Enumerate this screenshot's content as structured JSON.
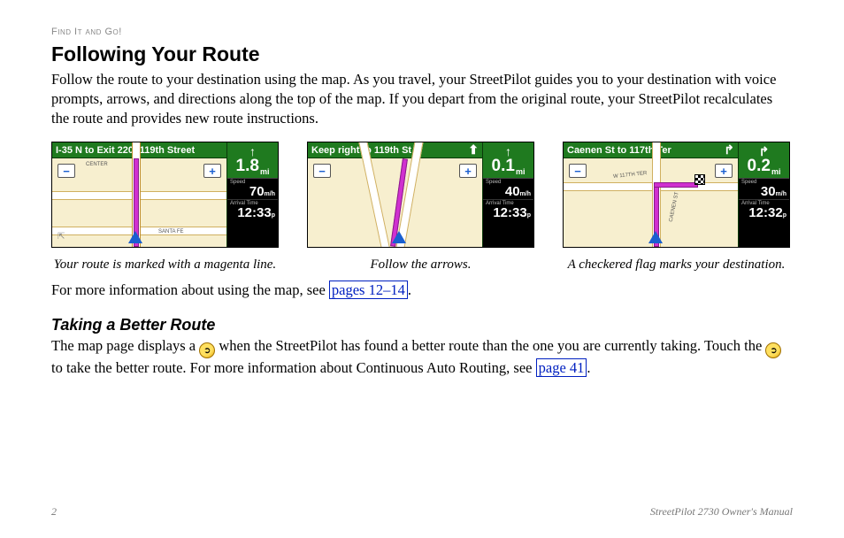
{
  "breadcrumb": "Find It and Go!",
  "heading": "Following Your Route",
  "intro": "Follow the route to your destination using the map. As you travel, your StreetPilot guides you to your destination with voice prompts, arrows, and directions along the top of the map. If you depart from the original route, your StreetPilot recalculates the route and provides new route instructions.",
  "figures": [
    {
      "topbar": "I-35 N to Exit 220: 119th Street",
      "dist": "1.8",
      "dist_unit": "mi",
      "speed": "70",
      "speed_unit": "m/h",
      "arrival_label": "Arrival Time",
      "arrival": "12:33",
      "arrival_ampm": "p",
      "map_labels": [
        "CENTER",
        "SANTA FE"
      ],
      "caption": "Your route is marked with a magenta line."
    },
    {
      "topbar": "Keep right to 119th St",
      "dist": "0.1",
      "dist_unit": "mi",
      "speed": "40",
      "speed_unit": "m/h",
      "arrival_label": "Arrival Time",
      "arrival": "12:33",
      "arrival_ampm": "p",
      "map_labels": [],
      "caption": "Follow the arrows."
    },
    {
      "topbar": "Caenen St to 117th Ter",
      "dist": "0.2",
      "dist_unit": "mi",
      "speed": "30",
      "speed_unit": "m/h",
      "arrival_label": "Arrival Time",
      "arrival": "12:32",
      "arrival_ampm": "p",
      "map_labels": [
        "W 117TH TER",
        "CAENEN ST"
      ],
      "caption": "A checkered flag marks your destination."
    }
  ],
  "more_info_prefix": "For more information about using the map, see ",
  "more_info_link": "pages 12–14",
  "more_info_suffix": ".",
  "sub_heading": "Taking a Better Route",
  "better_para_1a": "The map page displays a ",
  "better_para_1b": " when the StreetPilot has found a better route than the one you are currently taking. Touch the ",
  "better_para_1c": " to take the better route. For more information about Continuous Auto Routing, see ",
  "better_link": "page 41",
  "better_suffix": ".",
  "speed_label": "Speed",
  "footer_page": "2",
  "footer_title": "StreetPilot 2730 Owner's Manual"
}
